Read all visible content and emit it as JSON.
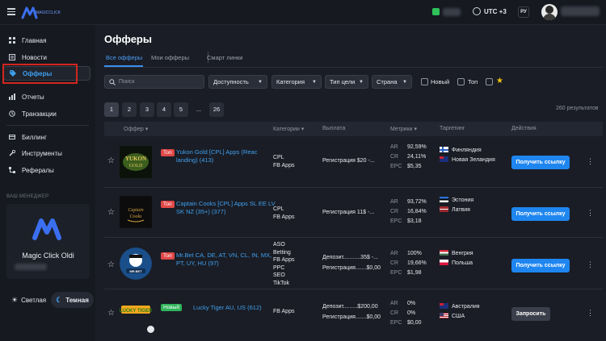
{
  "colors": {
    "accent": "#1f86f0",
    "link": "#3fa0f0",
    "badge_top": "#e04848",
    "badge_new": "#2fb45a",
    "highlight_box": "#d2261f"
  },
  "header": {
    "logo_text": "MAGICCLICK",
    "timezone": "UTC +3",
    "language": "РУ",
    "icons": [
      "menu-icon",
      "wallet-icon",
      "clock-icon"
    ]
  },
  "sidebar": {
    "items": [
      {
        "label": "Главная",
        "icon": "grid-icon"
      },
      {
        "label": "Новости",
        "icon": "news-icon"
      },
      {
        "label": "Офферы",
        "icon": "tag-icon",
        "active": true
      },
      {
        "label": "Отчеты",
        "icon": "bar-chart-icon"
      },
      {
        "label": "Транзакции",
        "icon": "history-icon"
      },
      {
        "label": "Биллинг",
        "icon": "card-icon"
      },
      {
        "label": "Инструменты",
        "icon": "wrench-icon"
      },
      {
        "label": "Рефералы",
        "icon": "referrals-icon"
      }
    ],
    "manager_title": "ВАШ МЕНЕДЖЕР",
    "manager_name": "Magic Click Oldi",
    "theme_light": "Светлая",
    "theme_dark": "Темная"
  },
  "main": {
    "title": "Офферы",
    "tabs": [
      "Все офферы",
      "Мои офферы",
      "Смарт линки"
    ],
    "search_placeholder": "Поиск",
    "filters": [
      "Доступность",
      "Категория",
      "Тип цели",
      "Страна"
    ],
    "checkbox_new": "Новый",
    "checkbox_top": "Топ",
    "pages": [
      "1",
      "2",
      "3",
      "4",
      "5",
      "...",
      "26"
    ],
    "results": "260 результатов",
    "columns": [
      "Оффер",
      "Категории",
      "Выплата",
      "Метрики",
      "Таргетинг",
      "Действия"
    ],
    "rows": [
      {
        "badge": "Топ",
        "name": "Yukon Gold [CPL] Apps (Reac landing) (413)",
        "categories": [
          "CPL",
          "FB Apps"
        ],
        "payouts": [
          "Регистрация $20 -..."
        ],
        "metrics": {
          "AR": "92,59%",
          "CR": "24,11%",
          "EPC": "$5,35"
        },
        "geo": [
          "Финляндия",
          "Новая Зеландия"
        ],
        "action": "Получить ссылку"
      },
      {
        "badge": "Топ",
        "name": "Captain Cooks [CPL] Apps SL EE LV SK NZ (35+) (377)",
        "categories": [
          "CPL",
          "FB Apps"
        ],
        "payouts": [
          "Регистрация 11$ -..."
        ],
        "metrics": {
          "AR": "93,72%",
          "CR": "16,84%",
          "EPC": "$3,18"
        },
        "geo": [
          "Эстония",
          "Латвия"
        ],
        "action": "Получить ссылку"
      },
      {
        "badge": "Топ",
        "name": "Mr.Bet CA, DE, AT, VN, CL, IN, MX, PT, UY, HU (97)",
        "categories": [
          "ASO",
          "Betting",
          "FB Apps",
          "PPC",
          "SEO",
          "TikTok"
        ],
        "payouts": [
          "Депозит...........35$ -...",
          "Регистрация.......$0,00"
        ],
        "metrics": {
          "AR": "100%",
          "CR": "19,66%",
          "EPC": "$1,98"
        },
        "geo": [
          "Венгрия",
          "Польша"
        ],
        "action": "Получить ссылку"
      },
      {
        "badge": "Новый",
        "name": "Lucky Tiger AU, US (612)",
        "categories": [
          "FB Apps"
        ],
        "payouts": [
          "Депозит.........$200,00",
          "Регистрация.......$0,00"
        ],
        "metrics": {
          "AR": "0%",
          "CR": "0%",
          "EPC": "$0,00"
        },
        "geo": [
          "Австралия",
          "США"
        ],
        "action": "Запросить"
      }
    ]
  }
}
